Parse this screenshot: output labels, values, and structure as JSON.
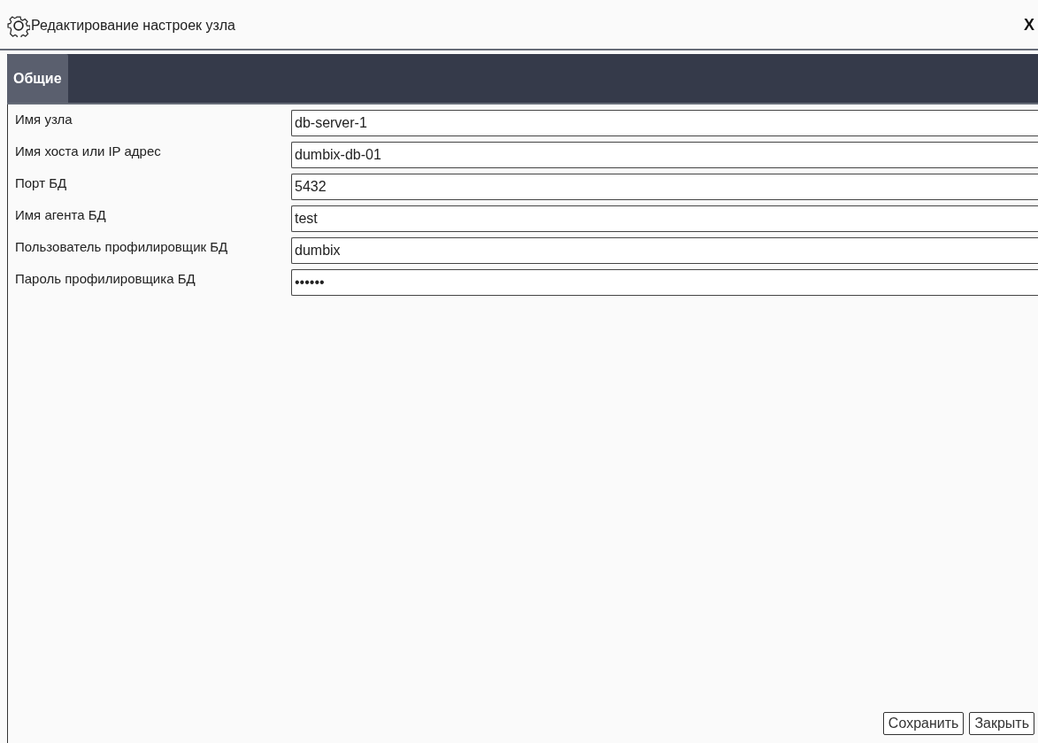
{
  "window": {
    "title": "Редактирование настроек узла",
    "close": "X"
  },
  "tabs": [
    {
      "label": "Общие",
      "selected": true
    }
  ],
  "fields": [
    {
      "label": "Имя узла",
      "value": "db-server-1"
    },
    {
      "label": "Имя хоста или IP адрес",
      "value": "dumbix-db-01"
    },
    {
      "label": "Порт БД",
      "value": "5432"
    },
    {
      "label": "Имя агента БД",
      "value": "test"
    },
    {
      "label": "Пользователь профилировщик БД",
      "value": "dumbix"
    },
    {
      "label": "Пароль профилировщика БД",
      "value": "••••••"
    }
  ],
  "buttons": [
    "Сохранить",
    "Закрыть"
  ]
}
